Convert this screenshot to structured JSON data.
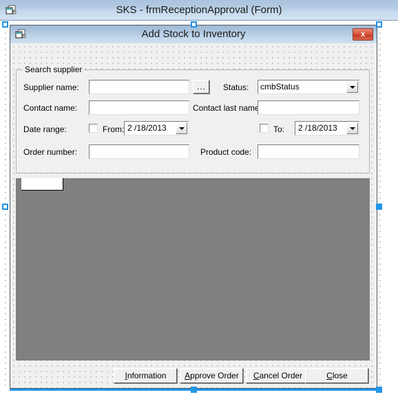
{
  "outer_window": {
    "title": "SKS - frmReceptionApproval (Form)",
    "icon": "form-designer-icon"
  },
  "inner_form": {
    "title": "Add Stock to Inventory",
    "icon": "form-icon",
    "close_label": "x"
  },
  "groupbox": {
    "legend": "Search supplier"
  },
  "fields": {
    "supplier_name_label": "Supplier name:",
    "supplier_name_value": "",
    "browse_label": "...",
    "status_label": "Status:",
    "status_value": "cmbStatus",
    "contact_name_label": "Contact name:",
    "contact_name_value": "",
    "contact_last_name_label": "Contact last name:",
    "contact_last_name_value": "",
    "date_range_label": "Date range:",
    "from_label": "From:",
    "from_date": "2 /18/2013",
    "to_label": "To:",
    "to_date": "2 /18/2013",
    "order_number_label": "Order number:",
    "order_number_value": "",
    "product_code_label": "Product code:",
    "product_code_value": ""
  },
  "buttons": {
    "information": {
      "accel": "I",
      "rest": "nformation"
    },
    "approve_order": {
      "accel": "A",
      "rest": "pprove Order"
    },
    "cancel_order": {
      "accel": "C",
      "rest": "ancel Order"
    },
    "close": {
      "accel": "C",
      "rest": "lose"
    }
  },
  "colors": {
    "titlebar_blue": "#b6cbe3",
    "selection_blue": "#2196e8",
    "grid_panel_gray": "#808080",
    "form_face": "#f0f0f0",
    "close_red": "#d85640"
  }
}
